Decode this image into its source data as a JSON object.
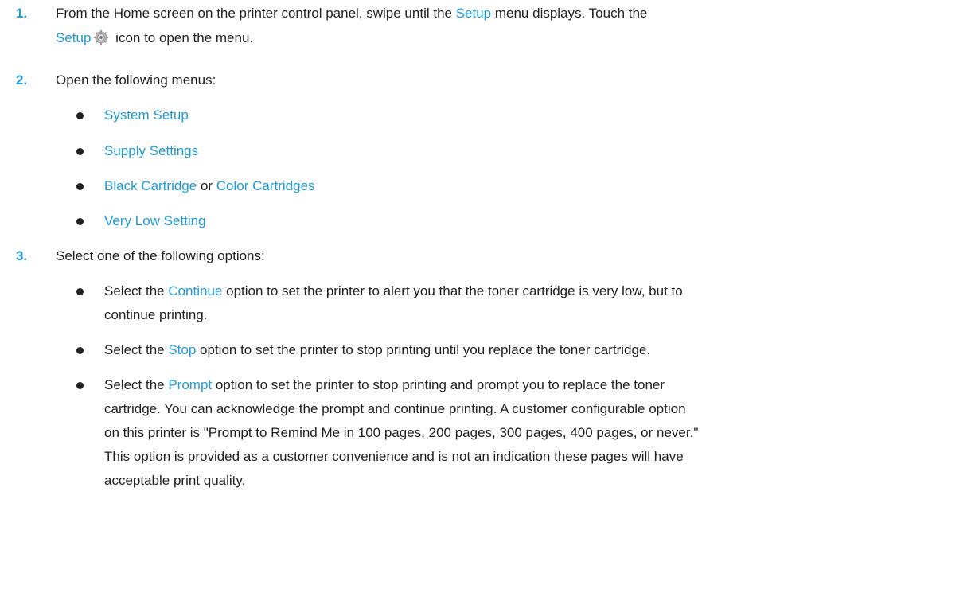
{
  "steps": [
    {
      "number": "1.",
      "line1": {
        "pre": "From the Home screen on the printer control panel, swipe until the ",
        "ui": "Setup",
        "post": " menu displays. Touch the"
      },
      "line2": {
        "ui": "Setup",
        "icon": "gear-icon",
        "post": " icon to open the menu."
      }
    },
    {
      "number": "2.",
      "text": "Open the following menus:",
      "bullets": [
        {
          "ui": "System Setup"
        },
        {
          "ui": "Supply Settings"
        },
        {
          "ui": "Black Cartridge",
          "mid": " or ",
          "ui2": "Color Cartridges"
        },
        {
          "ui": "Very Low Setting"
        }
      ]
    },
    {
      "number": "3.",
      "text": "Select one of the following options:",
      "bullets": [
        {
          "pre": "Select the ",
          "ui": "Continue",
          "post1": " option to set the printer to alert you that the toner cartridge is very low, but to",
          "post2": "continue printing."
        },
        {
          "pre": "Select the ",
          "ui": "Stop",
          "post1": " option to set the printer to stop printing until you replace the toner cartridge."
        },
        {
          "pre": "Select the ",
          "ui": "Prompt",
          "post1": " option to set the printer to stop printing and prompt you to replace the toner",
          "post2": "cartridge. You can acknowledge the prompt and continue printing. A customer configurable option",
          "post3": "on this printer is \"Prompt to Remind Me in 100 pages, 200 pages, 300 pages, 400 pages, or never.\"",
          "post4": "This option is provided as a customer convenience and is not an indication these pages will have",
          "post5": "acceptable print quality."
        }
      ]
    }
  ],
  "colors": {
    "accent": "#1f9ad6",
    "text": "#231f20"
  }
}
